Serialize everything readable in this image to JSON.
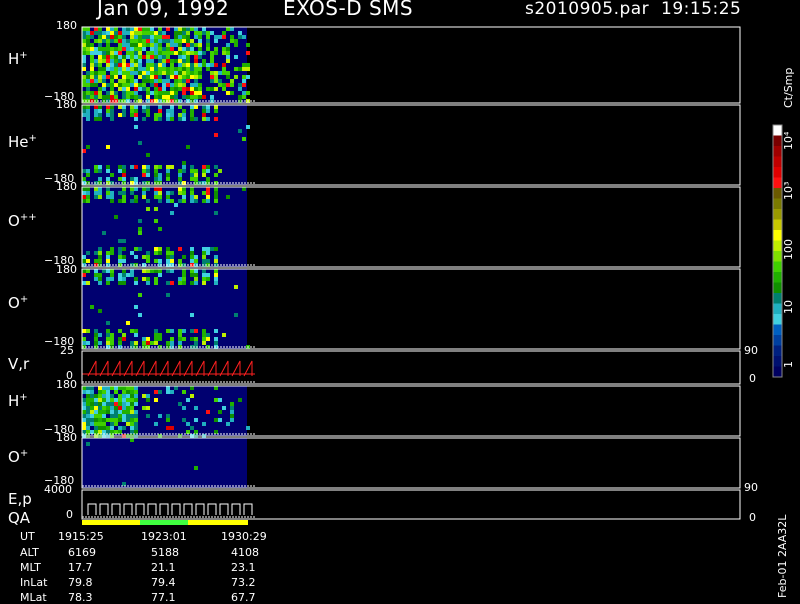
{
  "header": {
    "date": "Jan 09, 1992",
    "instrument": "EXOS-D SMS",
    "file": "s2010905.par",
    "time": "19:15:25"
  },
  "panels": [
    {
      "id": "H1",
      "label": "H",
      "sup": "+",
      "ymax": "180",
      "ymin": "−180"
    },
    {
      "id": "He",
      "label": "He",
      "sup": "+",
      "ymax": "180",
      "ymin": "−180"
    },
    {
      "id": "Opp",
      "label": "O",
      "sup": "++",
      "ymax": "180",
      "ymin": "−180"
    },
    {
      "id": "O1",
      "label": "O",
      "sup": "+",
      "ymax": "180",
      "ymin": "−180"
    },
    {
      "id": "V",
      "label": "V,r",
      "sup": "",
      "ymax": "25",
      "ymin": "0",
      "rmax": "90",
      "rmin": "0"
    },
    {
      "id": "H2",
      "label": "H",
      "sup": "+",
      "ymax": "180",
      "ymin": "−180"
    },
    {
      "id": "O2",
      "label": "O",
      "sup": "+",
      "ymax": "180",
      "ymin": "−180"
    },
    {
      "id": "E",
      "label": "E,p",
      "sup": "",
      "ymax": "4000",
      "ymin": "0",
      "rmax": "90",
      "rmin": "0"
    }
  ],
  "qa_label": "QA",
  "colorbar": {
    "unit": "Ct/Smp",
    "labels": [
      "10⁴",
      "10³",
      "100",
      "10",
      "1"
    ],
    "colors": [
      "#ffffff",
      "#7a0000",
      "#a00000",
      "#c00000",
      "#e00000",
      "#ff1010",
      "#6b5a00",
      "#7a7a00",
      "#9a9a00",
      "#c8c800",
      "#ffff00",
      "#c0f000",
      "#80e000",
      "#40d000",
      "#20b000",
      "#109000",
      "#008070",
      "#20b0c0",
      "#40d0e0",
      "#0060c0",
      "#0040a0",
      "#002080",
      "#001070",
      "#000060"
    ]
  },
  "side_note": "Feb-01 2AA32L",
  "orbit": {
    "rows": [
      {
        "label": "UT",
        "values": [
          "1915:25",
          "1923:01",
          "1930:29"
        ]
      },
      {
        "label": "ALT",
        "values": [
          "6169",
          "5188",
          "4108"
        ]
      },
      {
        "label": "MLT",
        "values": [
          "17.7",
          "21.1",
          "23.1"
        ]
      },
      {
        "label": "InLat",
        "values": [
          "79.8",
          "79.4",
          "73.2"
        ]
      },
      {
        "label": "MLat",
        "values": [
          "78.3",
          "77.1",
          "67.7"
        ]
      }
    ]
  },
  "chart_data": {
    "type": "heatmap",
    "x_ticks_ut": [
      "1915:25",
      "1923:01",
      "1930:29"
    ],
    "data_end_fraction": 0.25,
    "colorbar_scale": "log",
    "colorbar_range": [
      1,
      10000
    ],
    "panels_y_range": [
      [
        -180,
        180
      ],
      [
        -180,
        180
      ],
      [
        -180,
        180
      ],
      [
        -180,
        180
      ],
      [
        0,
        25
      ],
      [
        -180,
        180
      ],
      [
        -180,
        180
      ],
      [
        0,
        4000
      ]
    ]
  }
}
